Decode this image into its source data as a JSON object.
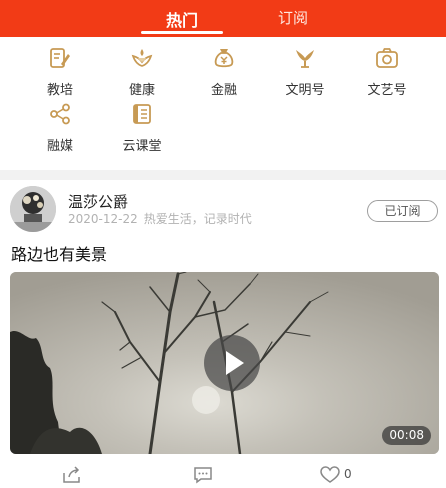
{
  "tabs": {
    "hot": "热门",
    "subscribe": "订阅"
  },
  "categories": [
    {
      "label": "教培",
      "icon": "edit-document-icon"
    },
    {
      "label": "健康",
      "icon": "health-icon"
    },
    {
      "label": "金融",
      "icon": "finance-icon"
    },
    {
      "label": "文明号",
      "icon": "civilization-icon"
    },
    {
      "label": "文艺号",
      "icon": "camera-icon"
    },
    {
      "label": "融媒",
      "icon": "share-network-icon"
    },
    {
      "label": "云课堂",
      "icon": "book-icon"
    }
  ],
  "post": {
    "author": "温莎公爵",
    "date": "2020-12-22",
    "signature": "热爱生活，记录时代",
    "subscribe_label": "已订阅",
    "title": "路边也有美景",
    "video_duration": "00:08",
    "like_count": "0"
  },
  "colors": {
    "accent": "#f23b16",
    "icon_gold": "#c79a54"
  }
}
